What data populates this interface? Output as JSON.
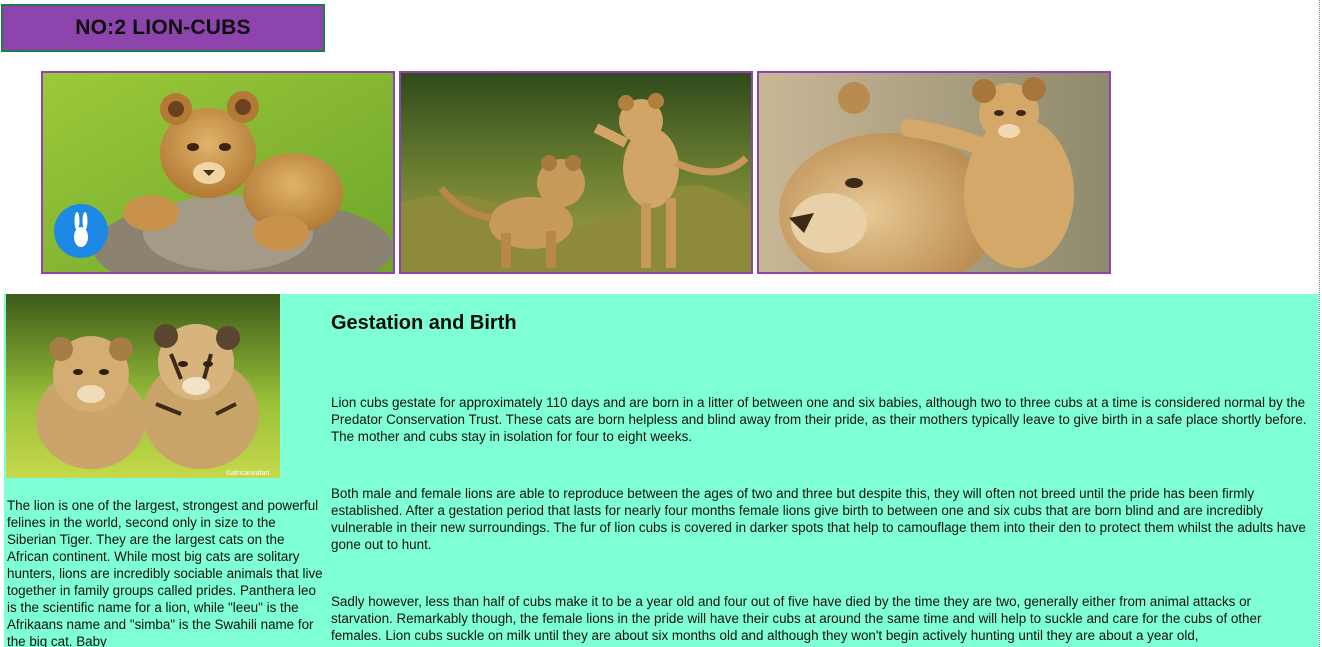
{
  "header": {
    "title": "NO:2 LION-CUBS"
  },
  "gallery": {
    "photos": [
      {
        "name": "lion cub resting on rock",
        "badge_icon": "rabbit-icon"
      },
      {
        "name": "two lion cubs playing"
      },
      {
        "name": "lioness with cub on head"
      }
    ]
  },
  "sidebar": {
    "photo_watermark": "©africansafari",
    "text": "The lion is one of the largest, strongest and powerful felines in the world, second only in size to the Siberian Tiger. They are the largest cats on the African continent. While most big cats are solitary hunters, lions are incredibly sociable animals that live together in family groups called prides. Panthera leo is the scientific name for a lion, while \"leeu\" is the Afrikaans name and \"simba\" is the Swahili name for the big cat. Baby"
  },
  "article": {
    "heading": "Gestation and Birth",
    "paragraphs": [
      "Lion cubs gestate for approximately 110 days and are born in a litter of between one and six babies, although two to three cubs at a time is considered normal by the Predator Conservation Trust. These cats are born helpless and blind away from their pride, as their mothers typically leave to give birth in a safe place shortly before. The mother and cubs stay in isolation for four to eight weeks.",
      "Both male and female lions are able to reproduce between the ages of two and three but despite this, they will often not breed until the pride has been firmly established. After a gestation period that lasts for nearly four months female lions give birth to between one and six cubs that are born blind and are incredibly vulnerable in their new surroundings. The fur of lion cubs is covered in darker spots that help to camouflage them into their den to protect them whilst the adults have gone out to hunt.",
      "Sadly however, less than half of cubs make it to be a year old and four out of five have died by the time they are two, generally either from animal attacks or starvation. Remarkably though, the female lions in the pride will have their cubs at around the same time and will help to suckle and care for the cubs of other females. Lion cubs suckle on milk until they are about six months old and although they won't begin actively hunting until they are about a year old,"
    ]
  },
  "colors": {
    "title_bg": "#8e44ad",
    "title_border": "#1f7a4d",
    "photo_border": "#8e44ad",
    "content_bg": "#7fffd4",
    "badge": "#1e88e5"
  }
}
